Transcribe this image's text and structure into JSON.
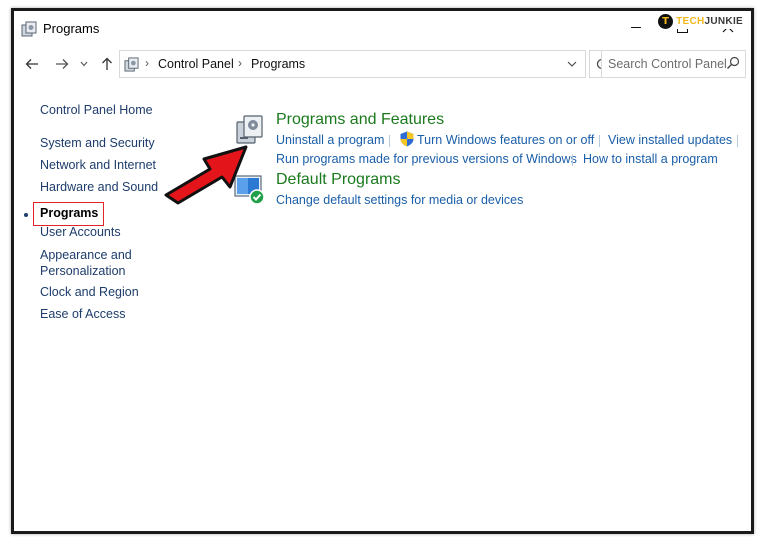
{
  "window": {
    "title": "Programs"
  },
  "watermark": {
    "logo_letter": "T",
    "brand_part1": "TECH",
    "brand_part2": "JUNKIE"
  },
  "address_bar": {
    "breadcrumbs": [
      "Control Panel",
      "Programs"
    ],
    "search_placeholder": "Search Control Panel"
  },
  "sidebar": {
    "home": "Control Panel Home",
    "items": [
      {
        "label": "System and Security"
      },
      {
        "label": "Network and Internet"
      },
      {
        "label": "Hardware and Sound"
      },
      {
        "label": "Programs",
        "current": true
      },
      {
        "label": "User Accounts"
      },
      {
        "label": "Appearance and"
      },
      {
        "label": "Personalization"
      },
      {
        "label": "Clock and Region"
      },
      {
        "label": "Ease of Access"
      }
    ]
  },
  "main": {
    "categories": [
      {
        "title": "Programs and Features",
        "icon": "programs-features-icon",
        "links": [
          "Uninstall a program",
          "Turn Windows features on or off",
          "View installed updates",
          "Run programs made for previous versions of Windows",
          "How to install a program"
        ]
      },
      {
        "title": "Default Programs",
        "icon": "default-programs-icon",
        "links": [
          "Change default settings for media or devices"
        ]
      }
    ]
  },
  "colors": {
    "category_title": "#1b7a1e",
    "link": "#1a5ea8",
    "sidebar_link": "#1e3d6b",
    "highlight_box": "#e0242a",
    "annotation_arrow": "#e0242a"
  }
}
